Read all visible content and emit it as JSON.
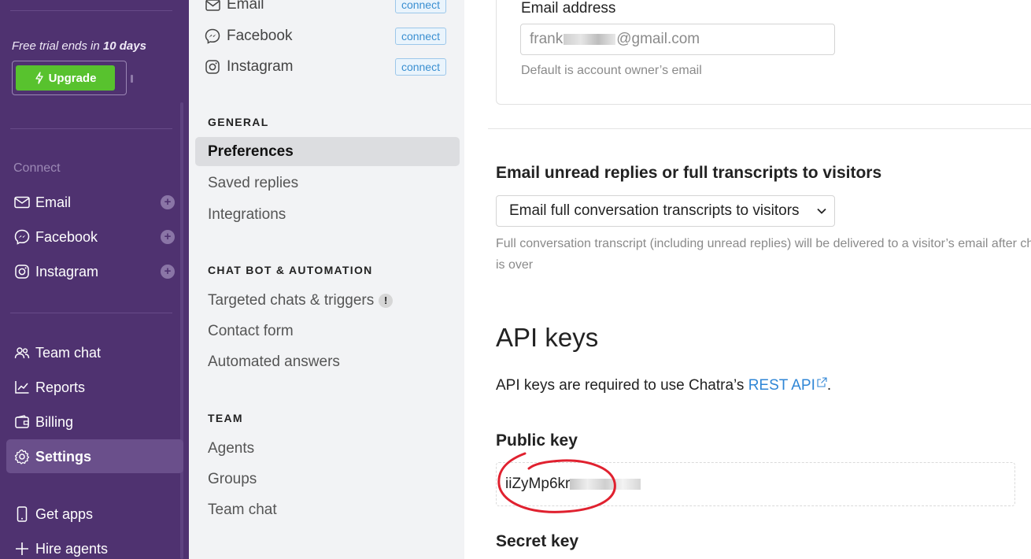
{
  "sidebar": {
    "trial_prefix": "Free trial ends in",
    "trial_days": "10 days",
    "upgrade_label": "Upgrade",
    "connect_heading": "Connect",
    "connect_items": [
      {
        "label": "Email",
        "icon": "envelope-icon"
      },
      {
        "label": "Facebook",
        "icon": "messenger-icon"
      },
      {
        "label": "Instagram",
        "icon": "instagram-icon"
      }
    ],
    "nav_items": [
      {
        "label": "Team chat",
        "icon": "people-icon"
      },
      {
        "label": "Reports",
        "icon": "chart-icon"
      },
      {
        "label": "Billing",
        "icon": "wallet-icon"
      },
      {
        "label": "Settings",
        "icon": "gear-icon",
        "active": true
      }
    ],
    "bottom_items": [
      {
        "label": "Get apps",
        "icon": "phone-icon"
      },
      {
        "label": "Hire agents",
        "icon": "plus-icon"
      }
    ],
    "colors": {
      "background": "#4f3270",
      "upgrade": "#58c22e",
      "active": "#6a4f8b"
    }
  },
  "settings_nav": {
    "channels": [
      {
        "label": "Email",
        "badge": "connect"
      },
      {
        "label": "Facebook",
        "badge": "connect"
      },
      {
        "label": "Instagram",
        "badge": "connect"
      }
    ],
    "sections": [
      {
        "heading": "GENERAL",
        "items": [
          "Preferences",
          "Saved replies",
          "Integrations"
        ]
      },
      {
        "heading": "CHAT BOT & AUTOMATION",
        "items": [
          "Targeted chats & triggers",
          "Contact form",
          "Automated answers"
        ]
      },
      {
        "heading": "TEAM",
        "items": [
          "Agents",
          "Groups",
          "Team chat"
        ]
      }
    ],
    "active_item": "Preferences",
    "warning_badge": "!"
  },
  "main": {
    "email_label": "Email address",
    "email_value_start": "frank",
    "email_value_end": "@gmail.com",
    "email_help": "Default is account owner’s email",
    "transcript_heading": "Email unread replies or full transcripts to visitors",
    "transcript_selected": "Email full conversation transcripts to visitors",
    "transcript_help": "Full conversation transcript (including unread replies) will be delivered to a visitor’s email after chat is over",
    "api_title": "API keys",
    "api_desc_prefix": "API keys are required to use Chatra’s",
    "api_link": "REST API",
    "api_desc_suffix": ".",
    "public_key_label": "Public key",
    "public_key_visible": "iiZyMp6kr",
    "secret_key_label": "Secret key",
    "colors": {
      "link": "#2f86d6",
      "annotation": "#e0212f"
    }
  }
}
